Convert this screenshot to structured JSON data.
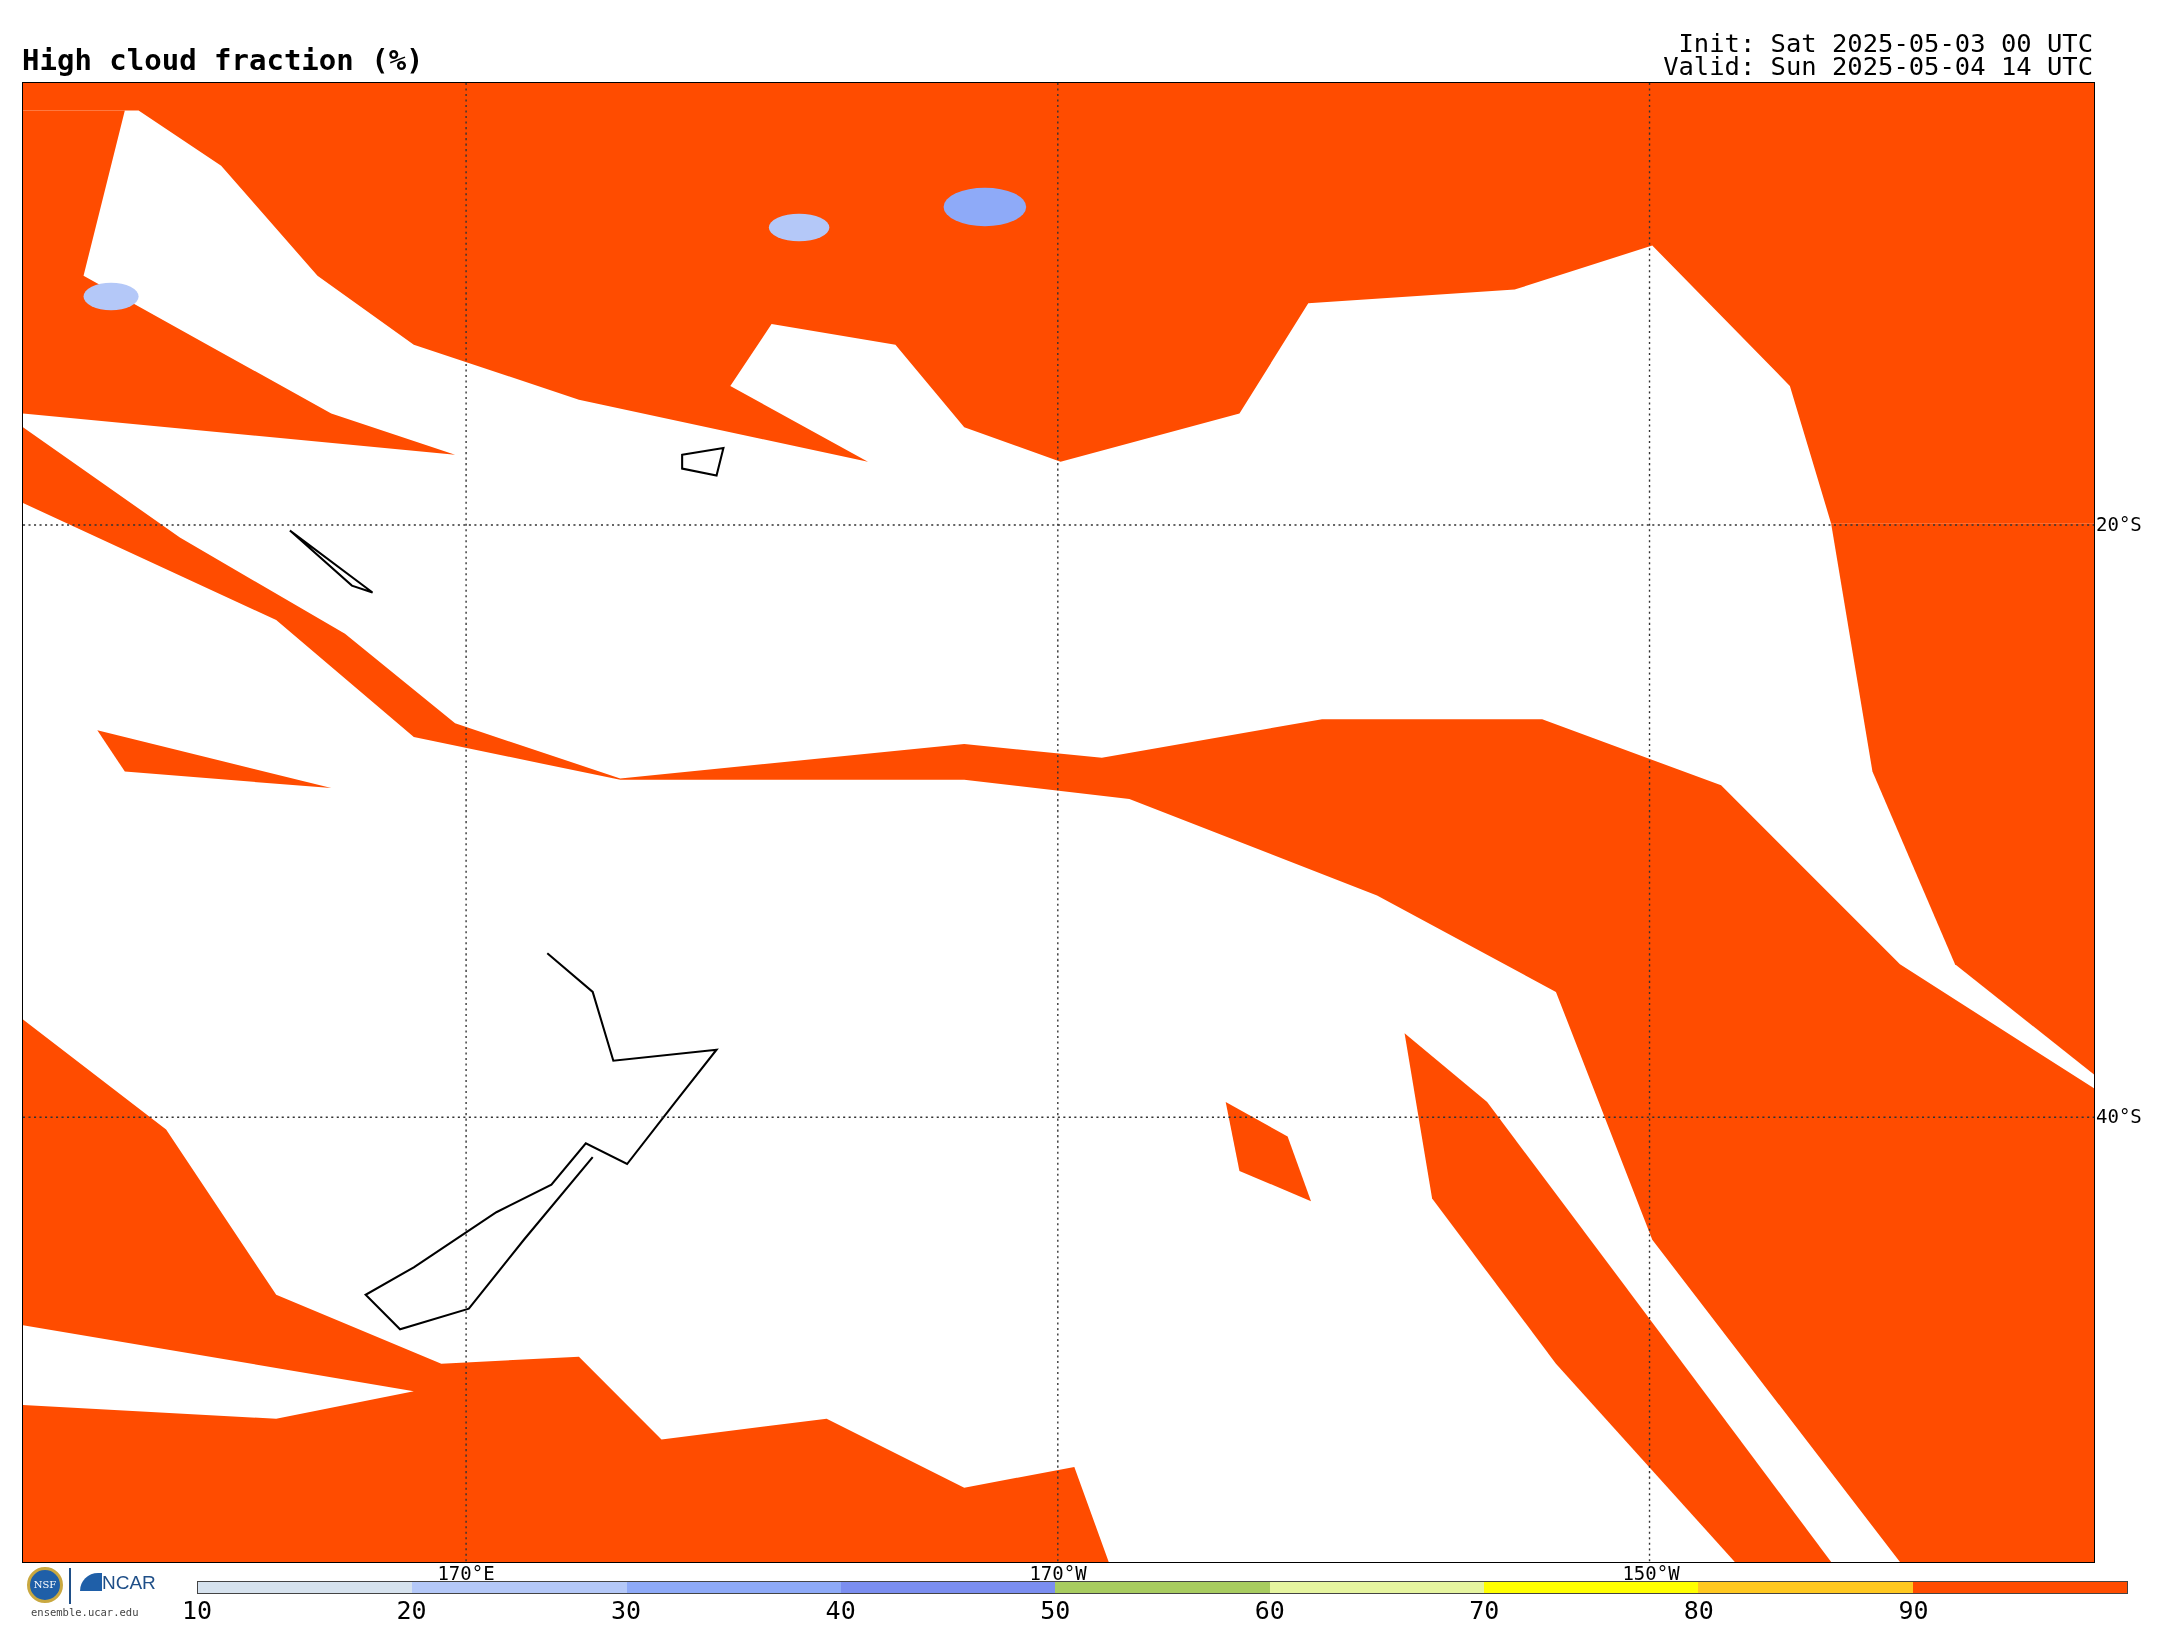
{
  "title": "High cloud fraction (%)",
  "init": "Init: Sat 2025-05-03 00 UTC",
  "valid": "Valid: Sun 2025-05-04 14 UTC",
  "map": {
    "lat_labels": [
      "20°S",
      "40°S"
    ],
    "lon_labels": [
      "170°E",
      "170°W",
      "150°W"
    ]
  },
  "logos": {
    "nsf": "NSF",
    "ncar": "NCAR",
    "url": "ensemble.ucar.edu"
  },
  "colorbar": {
    "segments": [
      {
        "color": "#d6e2ee"
      },
      {
        "color": "#b4c8f8"
      },
      {
        "color": "#8eaaf8"
      },
      {
        "color": "#7b8ef0"
      },
      {
        "color": "#a8cc60"
      },
      {
        "color": "#e6f5a0"
      },
      {
        "color": "#ffff00"
      },
      {
        "color": "#ffc820"
      },
      {
        "color": "#ff4c00"
      }
    ],
    "labels": [
      "10",
      "20",
      "30",
      "40",
      "50",
      "60",
      "70",
      "80",
      "90"
    ]
  }
}
